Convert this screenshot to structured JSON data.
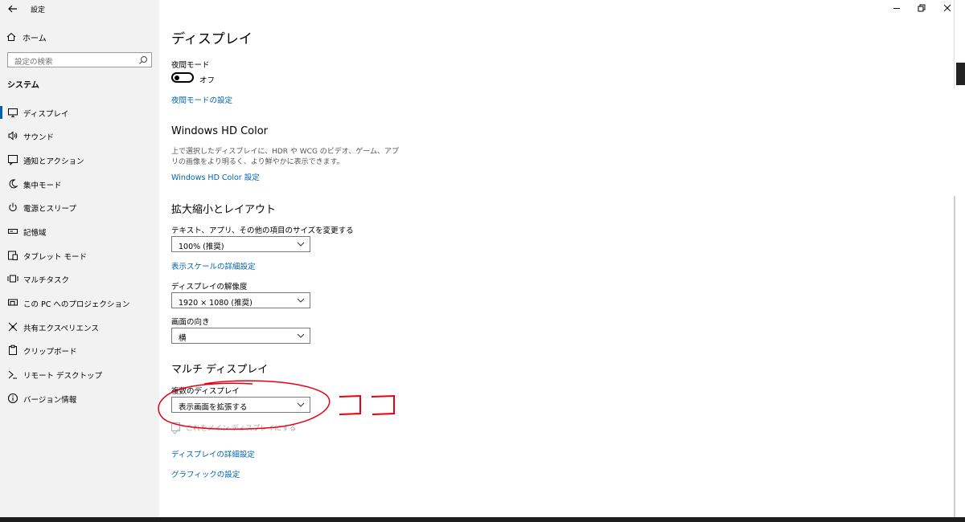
{
  "window": {
    "title": "設定",
    "controls": [
      "minimize",
      "maximize",
      "close"
    ]
  },
  "sidebar": {
    "home_label": "ホーム",
    "search_placeholder": "設定の検索",
    "section_title": "システム",
    "items": [
      {
        "label": "ディスプレイ",
        "icon": "monitor-icon",
        "active": true
      },
      {
        "label": "サウンド",
        "icon": "speaker-icon"
      },
      {
        "label": "通知とアクション",
        "icon": "notification-icon"
      },
      {
        "label": "集中モード",
        "icon": "moon-icon"
      },
      {
        "label": "電源とスリープ",
        "icon": "power-icon"
      },
      {
        "label": "記憶域",
        "icon": "storage-icon"
      },
      {
        "label": "タブレット モード",
        "icon": "tablet-icon"
      },
      {
        "label": "マルチタスク",
        "icon": "multitask-icon"
      },
      {
        "label": "この PC へのプロジェクション",
        "icon": "projection-icon"
      },
      {
        "label": "共有エクスペリエンス",
        "icon": "shared-icon"
      },
      {
        "label": "クリップボード",
        "icon": "clipboard-icon"
      },
      {
        "label": "リモート デスクトップ",
        "icon": "remote-icon"
      },
      {
        "label": "バージョン情報",
        "icon": "info-icon"
      }
    ]
  },
  "main": {
    "page_title": "ディスプレイ",
    "night_mode": {
      "label": "夜間モード",
      "state": "オフ",
      "settings_link": "夜間モードの設定"
    },
    "hd_color": {
      "heading": "Windows HD Color",
      "description": "上で選択したディスプレイに、HDR や WCG のビデオ、ゲーム、アプリの画像をより明るく、より鮮やかに表示できます。",
      "link": "Windows HD Color 設定"
    },
    "scale_layout": {
      "heading": "拡大縮小とレイアウト",
      "scale_label": "テキスト、アプリ、その他の項目のサイズを変更する",
      "scale_value": "100% (推奨)",
      "scale_link": "表示スケールの詳細設定",
      "resolution_label": "ディスプレイの解像度",
      "resolution_value": "1920 × 1080 (推奨)",
      "orientation_label": "画面の向き",
      "orientation_value": "横"
    },
    "multi_display": {
      "heading": "マルチ ディスプレイ",
      "multi_label": "複数のディスプレイ",
      "multi_value": "表示画面を拡張する",
      "main_display_checkbox": "これをメイン ディスプレイにする",
      "advanced_link": "ディスプレイの詳細設定",
      "graphics_link": "グラフィックの設定"
    }
  },
  "colors": {
    "accent": "#0063b1",
    "annotation": "#e60012",
    "sidebar_bg": "#f2f2f2"
  }
}
